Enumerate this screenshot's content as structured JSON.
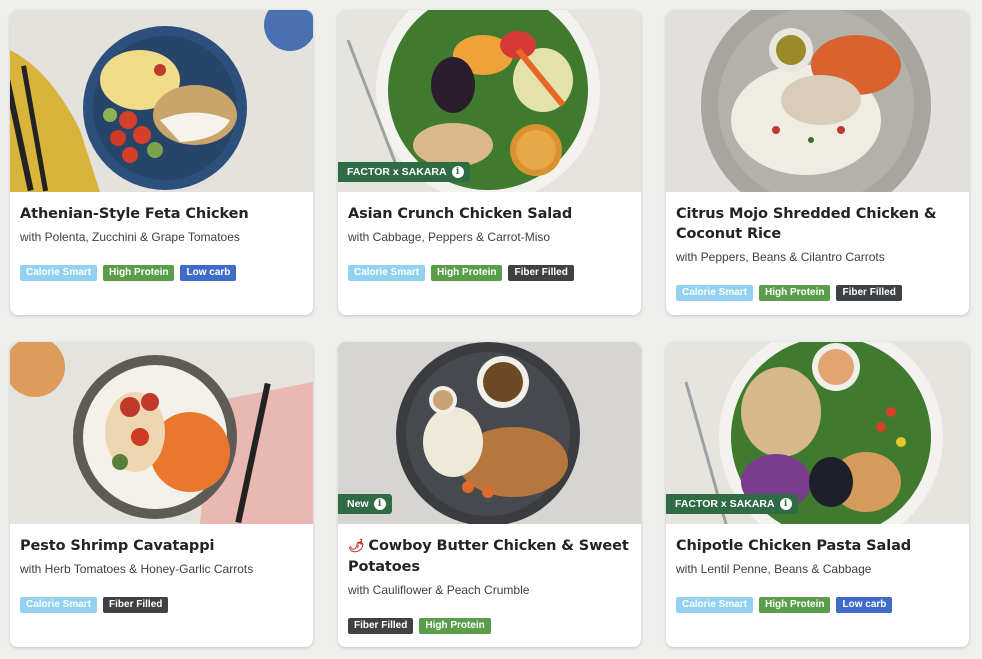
{
  "colors": {
    "calorie_smart": "#92d2f0",
    "high_protein": "#5a9e4a",
    "low_carb": "#3f6cc9",
    "fiber_filled": "#3e4245",
    "tag_green": "#2f6b43"
  },
  "meals": [
    {
      "title": "Athenian-Style Feta Chicken",
      "subtitle": "with Polenta, Zucchini & Grape Tomatoes",
      "tag": null,
      "badges": [
        "Calorie Smart",
        "High Protein",
        "Low carb"
      ]
    },
    {
      "title": "Asian Crunch Chicken Salad",
      "subtitle": "with Cabbage, Peppers & Carrot-Miso",
      "tag": "FACTOR x SAKARA",
      "badges": [
        "Calorie Smart",
        "High Protein",
        "Fiber Filled"
      ]
    },
    {
      "title": "Citrus Mojo Shredded Chicken & Coconut Rice",
      "subtitle": "with Peppers, Beans & Cilantro Carrots",
      "tag": null,
      "badges": [
        "Calorie Smart",
        "High Protein",
        "Fiber Filled"
      ]
    },
    {
      "title": "Pesto Shrimp Cavatappi",
      "subtitle": "with Herb Tomatoes & Honey-Garlic Carrots",
      "tag": null,
      "badges": [
        "Calorie Smart",
        "Fiber Filled"
      ]
    },
    {
      "title": "Cowboy Butter Chicken & Sweet Potatoes",
      "subtitle": "with Cauliflower & Peach Crumble",
      "tag": "New",
      "spicy_icon": "chili-pepper-icon",
      "badges": [
        "Fiber Filled",
        "High Protein"
      ]
    },
    {
      "title": "Chipotle Chicken Pasta Salad",
      "subtitle": "with Lentil Penne, Beans & Cabbage",
      "tag": "FACTOR x SAKARA",
      "badges": [
        "Calorie Smart",
        "High Protein",
        "Low carb"
      ]
    }
  ]
}
